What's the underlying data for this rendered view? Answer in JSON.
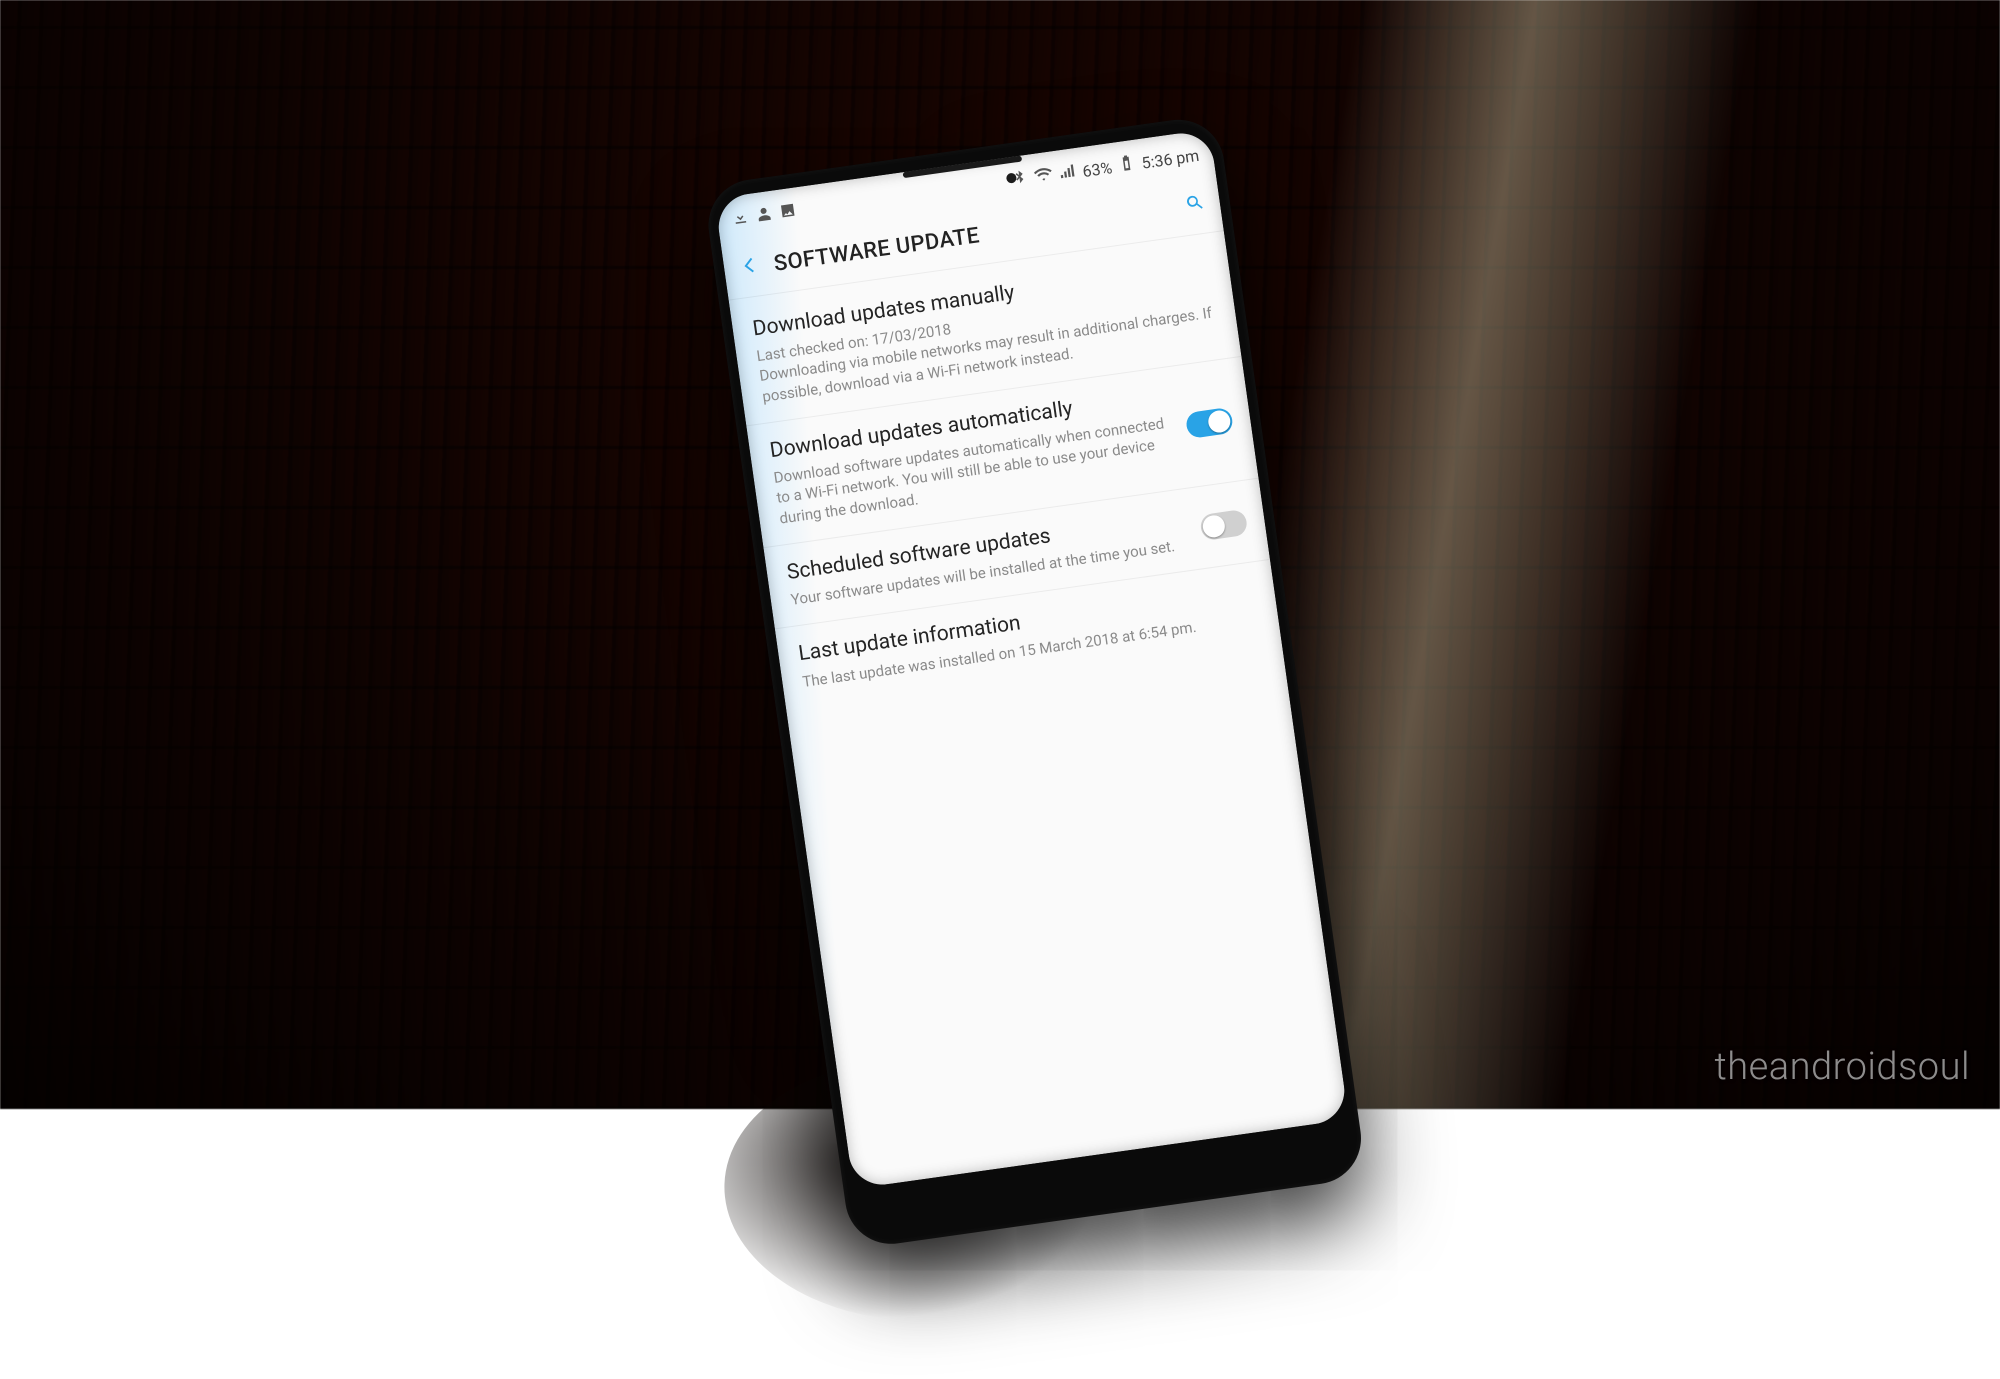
{
  "watermark": "theandroidsoul",
  "status": {
    "battery_pct": "63%",
    "clock": "5:36 pm"
  },
  "header": {
    "title": "SOFTWARE UPDATE"
  },
  "items": {
    "manual": {
      "title": "Download updates manually",
      "desc_line1": "Last checked on: 17/03/2018",
      "desc_line2": "Downloading via mobile networks may result in additional charges. If possible, download via a Wi-Fi network instead."
    },
    "auto": {
      "title": "Download updates automatically",
      "desc": "Download software updates automatically when connected to a Wi-Fi network. You will still be able to use your device during the download."
    },
    "scheduled": {
      "title": "Scheduled software updates",
      "desc": "Your software updates will be installed at the time you set."
    },
    "lastinfo": {
      "title": "Last update information",
      "desc": "The last update was installed on 15 March 2018 at 6:54 pm."
    }
  }
}
